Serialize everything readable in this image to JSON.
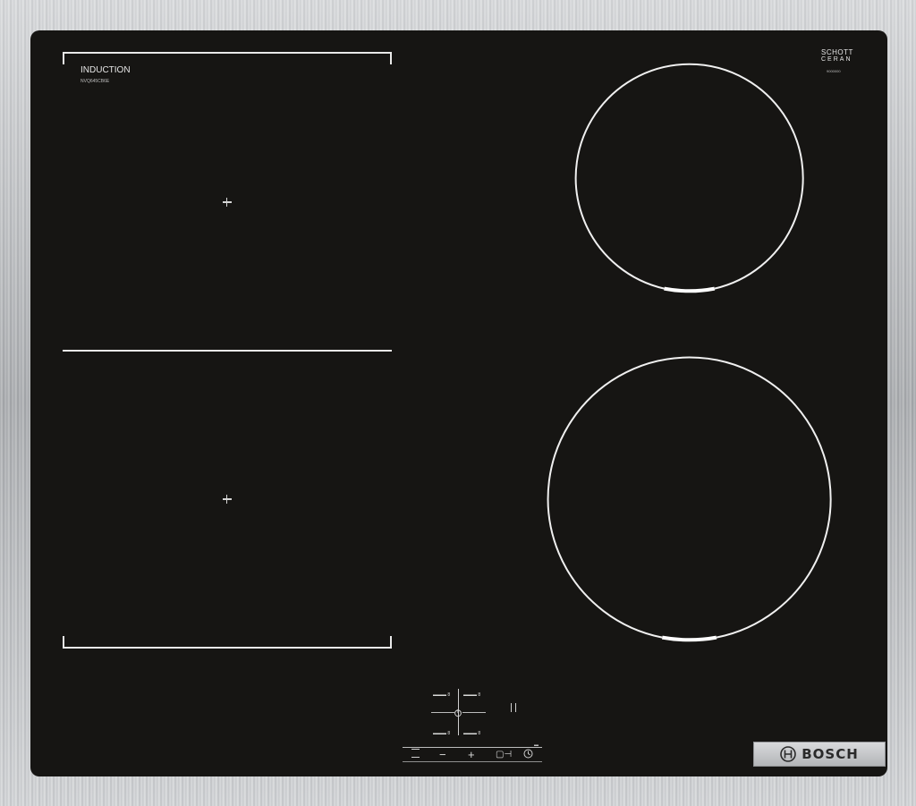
{
  "hob": {
    "label": "INDUCTION",
    "model": "NVQ645CB6E",
    "glass_brand_line1": "SCHOTT",
    "glass_brand_line2": "CERAN",
    "glass_model": "9000000",
    "brand": "BOSCH"
  },
  "controls": {
    "zone_labels": [
      "▬▬▬ 8",
      "▬▬▬ 8",
      "▬▬▬ 8",
      "▬▬▬ 8"
    ],
    "minus_label": "−",
    "plus_label": "+",
    "flex_label": "▢⊣",
    "timer_icon": "clock-icon",
    "power_icon": "power-icon",
    "small_mark": "▬"
  },
  "colors": {
    "glass": "#161513",
    "lines": "#e8e8e8",
    "frame": "#c2c4c7",
    "badge": "#c8c9cb"
  }
}
